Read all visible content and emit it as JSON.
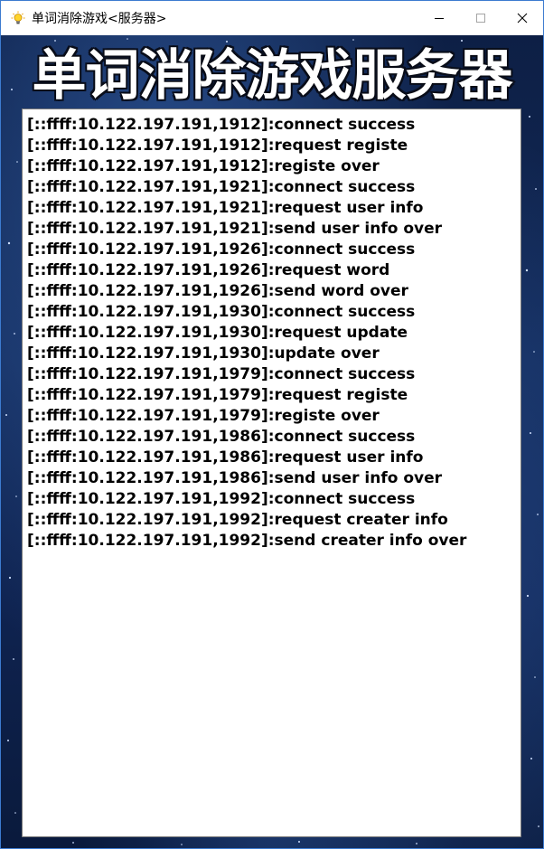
{
  "window": {
    "title": "单词消除游戏<服务器>",
    "icons": {
      "app": "lightbulb-icon",
      "minimize": "minimize-icon",
      "maximize": "maximize-icon",
      "close": "close-icon"
    },
    "accent_color": "#3c7bd0"
  },
  "banner": {
    "text": "单词消除游戏服务器"
  },
  "log": {
    "lines": [
      "[::ffff:10.122.197.191,1912]:connect success",
      "[::ffff:10.122.197.191,1912]:request registe",
      "[::ffff:10.122.197.191,1912]:registe over",
      "[::ffff:10.122.197.191,1921]:connect success",
      "[::ffff:10.122.197.191,1921]:request user info",
      "[::ffff:10.122.197.191,1921]:send user info over",
      "[::ffff:10.122.197.191,1926]:connect success",
      "[::ffff:10.122.197.191,1926]:request word",
      "[::ffff:10.122.197.191,1926]:send word over",
      "[::ffff:10.122.197.191,1930]:connect success",
      "[::ffff:10.122.197.191,1930]:request update",
      "[::ffff:10.122.197.191,1930]:update over",
      "[::ffff:10.122.197.191,1979]:connect success",
      "[::ffff:10.122.197.191,1979]:request registe",
      "[::ffff:10.122.197.191,1979]:registe over",
      "[::ffff:10.122.197.191,1986]:connect success",
      "[::ffff:10.122.197.191,1986]:request user info",
      "[::ffff:10.122.197.191,1986]:send user info over",
      "[::ffff:10.122.197.191,1992]:connect success",
      "[::ffff:10.122.197.191,1992]:request creater info",
      "[::ffff:10.122.197.191,1992]:send creater info over"
    ]
  }
}
